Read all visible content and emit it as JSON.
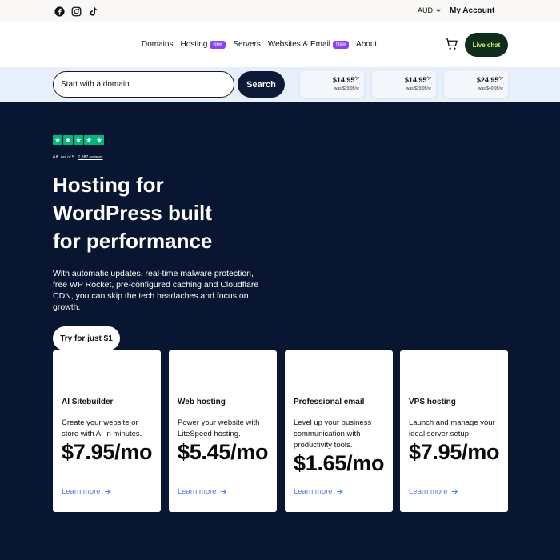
{
  "topbar": {
    "social": [
      {
        "icon": "facebook-icon"
      },
      {
        "icon": "instagram-icon"
      },
      {
        "icon": "tiktok-icon"
      }
    ],
    "currency": "AUD",
    "account": "My Account"
  },
  "nav": {
    "links": [
      {
        "label": "Domains",
        "badge": ""
      },
      {
        "label": "Hosting",
        "badge": "New"
      },
      {
        "label": "Servers",
        "badge": ""
      },
      {
        "label": "Websites & Email",
        "badge": "New"
      },
      {
        "label": "About",
        "badge": ""
      }
    ],
    "live_chat": "Live chat"
  },
  "search": {
    "placeholder": "Start with a domain",
    "button": "Search",
    "domain_prices": [
      {
        "price": "$14.95",
        "unit": "/yr",
        "was": "was $29.95/yr"
      },
      {
        "price": "$14.95",
        "unit": "/yr",
        "was": "was $29.95/yr"
      },
      {
        "price": "$24.95",
        "unit": "/yr",
        "was": "was $49.95/yr"
      }
    ]
  },
  "hero": {
    "rating_score": "4.8",
    "rating_out_of": "out of 5",
    "reviews": "1,387 reviews",
    "headline_1": "Hosting for",
    "headline_2": "WordPress built",
    "headline_3": "for performance",
    "description": "With automatic updates, real-time malware protection, free WP Rocket, pre-configured caching and Cloudflare CDN, you can skip the tech headaches and focus on growth.",
    "cta": "Try for just $1"
  },
  "cards": [
    {
      "title": "AI Sitebuilder",
      "description": "Create your website or store with AI in minutes.",
      "price": "$7.95/mo",
      "link": "Learn more"
    },
    {
      "title": "Web hosting",
      "description": "Power your website with LiteSpeed hosting.",
      "price": "$5.45/mo",
      "link": "Learn more"
    },
    {
      "title": "Professional email",
      "description": "Level up your business communication with productivity tools.",
      "price": "$1.65/mo",
      "link": "Learn more"
    },
    {
      "title": "VPS hosting",
      "description": "Launch and manage your ideal server setup.",
      "price": "$7.95/mo",
      "link": "Learn more"
    }
  ],
  "colors": {
    "hero_bg": "#081631",
    "badge": "#8a44f2",
    "live_chat_bg": "#0e2d1c",
    "live_chat_text": "#c9f26a",
    "trustpilot_green": "#04b67b",
    "link_blue": "#4a7ce0"
  }
}
